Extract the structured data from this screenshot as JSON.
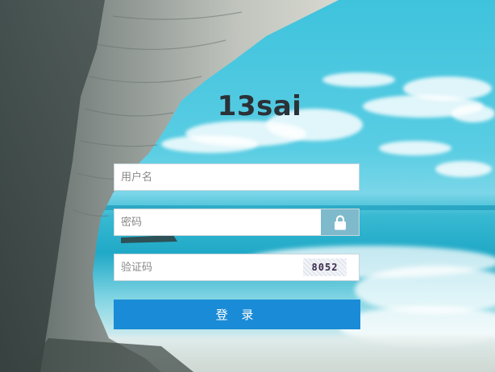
{
  "app": {
    "title": "13sai"
  },
  "form": {
    "username": {
      "value": "",
      "placeholder": "用户名",
      "icon": "user-icon"
    },
    "password": {
      "value": "",
      "placeholder": "密码",
      "icon": "lock-icon"
    },
    "captcha": {
      "value": "",
      "placeholder": "验证码",
      "code": "8052"
    },
    "submit_label": "登 录"
  },
  "colors": {
    "button": "#1a8bd6",
    "title": "#2b3136",
    "lock_box": "#1482a0"
  }
}
